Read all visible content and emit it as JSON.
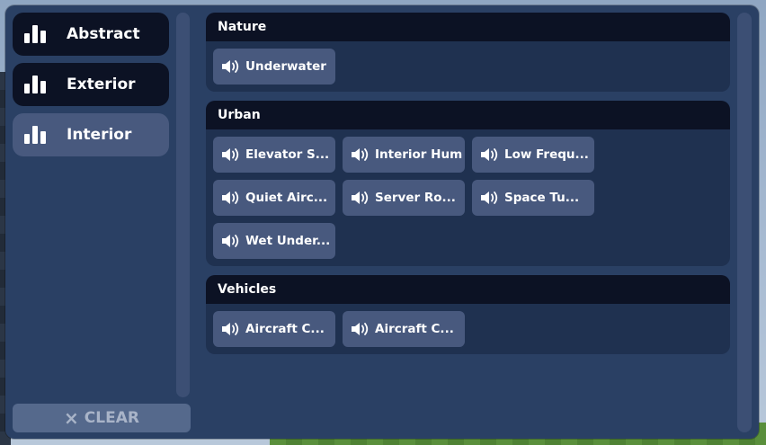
{
  "sidebar": {
    "categories": [
      {
        "label": "Abstract",
        "active": false
      },
      {
        "label": "Exterior",
        "active": false
      },
      {
        "label": "Interior",
        "active": true
      }
    ],
    "clear_label": "CLEAR",
    "clear_icon": "×"
  },
  "sections": [
    {
      "title": "Nature",
      "items": [
        "Underwater"
      ]
    },
    {
      "title": "Urban",
      "items": [
        "Elevator S...",
        "Interior Hum",
        "Low Frequ...",
        "Quiet Airc...",
        "Server Ro...",
        "Space Tu...",
        "Wet Under..."
      ]
    },
    {
      "title": "Vehicles",
      "items": [
        "Aircraft C...",
        "Aircraft C..."
      ]
    }
  ],
  "colors": {
    "panel": "#2a4064",
    "header": "#0c1224",
    "tile": "#48597e",
    "section": "#1f3150"
  }
}
